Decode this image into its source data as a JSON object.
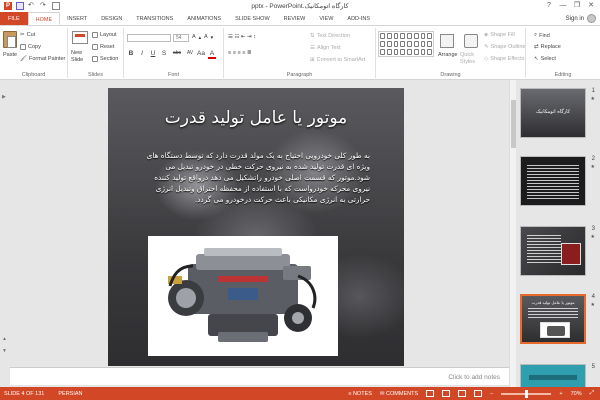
{
  "window": {
    "title": "‫کارگاه اتومکانیک.pptx - PowerPoint",
    "controls": [
      "?",
      "—",
      "❐",
      "✕"
    ]
  },
  "ribbon_tabs": [
    "FILE",
    "HOME",
    "INSERT",
    "DESIGN",
    "TRANSITIONS",
    "ANIMATIONS",
    "SLIDE SHOW",
    "REVIEW",
    "VIEW",
    "ADD-INS"
  ],
  "active_tab": "HOME",
  "signin": "Sign in",
  "clipboard": {
    "paste": "Paste",
    "cut": "Cut",
    "copy": "Copy",
    "format_painter": "Format Painter",
    "label": "Clipboard"
  },
  "slides_group": {
    "new_slide": "New Slide",
    "layout": "Layout",
    "reset": "Reset",
    "section": "Section",
    "label": "Slides"
  },
  "font_group": {
    "font_name": "",
    "font_size": "54",
    "buttons": [
      "B",
      "I",
      "U",
      "S",
      "abc",
      "AV",
      "Aa",
      "A"
    ],
    "label": "Font"
  },
  "paragraph_group": {
    "text_direction": "Text Direction",
    "align_text": "Align Text",
    "convert_smartart": "Convert to SmartArt",
    "label": "Paragraph"
  },
  "drawing_group": {
    "arrange": "Arrange",
    "quick_styles": "Quick Styles",
    "shape_fill": "Shape Fill",
    "shape_outline": "Shape Outline",
    "shape_effects": "Shape Effects",
    "label": "Drawing"
  },
  "editing_group": {
    "find": "Find",
    "replace": "Replace",
    "select": "Select",
    "label": "Editing"
  },
  "slide": {
    "title": "موتور یا عامل تولید قدرت",
    "body": "به طور کلی خودرویی احتیاج به یک مولد قدرت دارد که توسط دستگاه های ویژه ای قدرت تولید شده به نیروی حرکت خطی در خودرو تبدیل می شود.موتور که قسمت اصلی خودرو راتشکیل می دهد درواقع تولید کننده نیروی محرکه خودرواست که با استفاده از محفظه احتراق وتبدیل انرژی حرارتی به انرژی مکانیکی باعث حرکت درخودرو می گردد."
  },
  "thumbnails": [
    {
      "num": "1",
      "title": "کارگاه اتومکانیک",
      "selected": false
    },
    {
      "num": "2",
      "title": "",
      "selected": false
    },
    {
      "num": "3",
      "title": "",
      "selected": false
    },
    {
      "num": "4",
      "title": "موتور یا عامل تولید قدرت",
      "selected": true
    },
    {
      "num": "5",
      "title": "",
      "selected": false
    }
  ],
  "notes_placeholder": "Click to add notes",
  "status": {
    "slide_info": "SLIDE 4 OF 131",
    "language": "PERSIAN",
    "notes": "NOTES",
    "comments": "COMMENTS",
    "zoom": "70%"
  },
  "colors": {
    "accent": "#d24726",
    "selected_thumb": "#e8692c"
  }
}
